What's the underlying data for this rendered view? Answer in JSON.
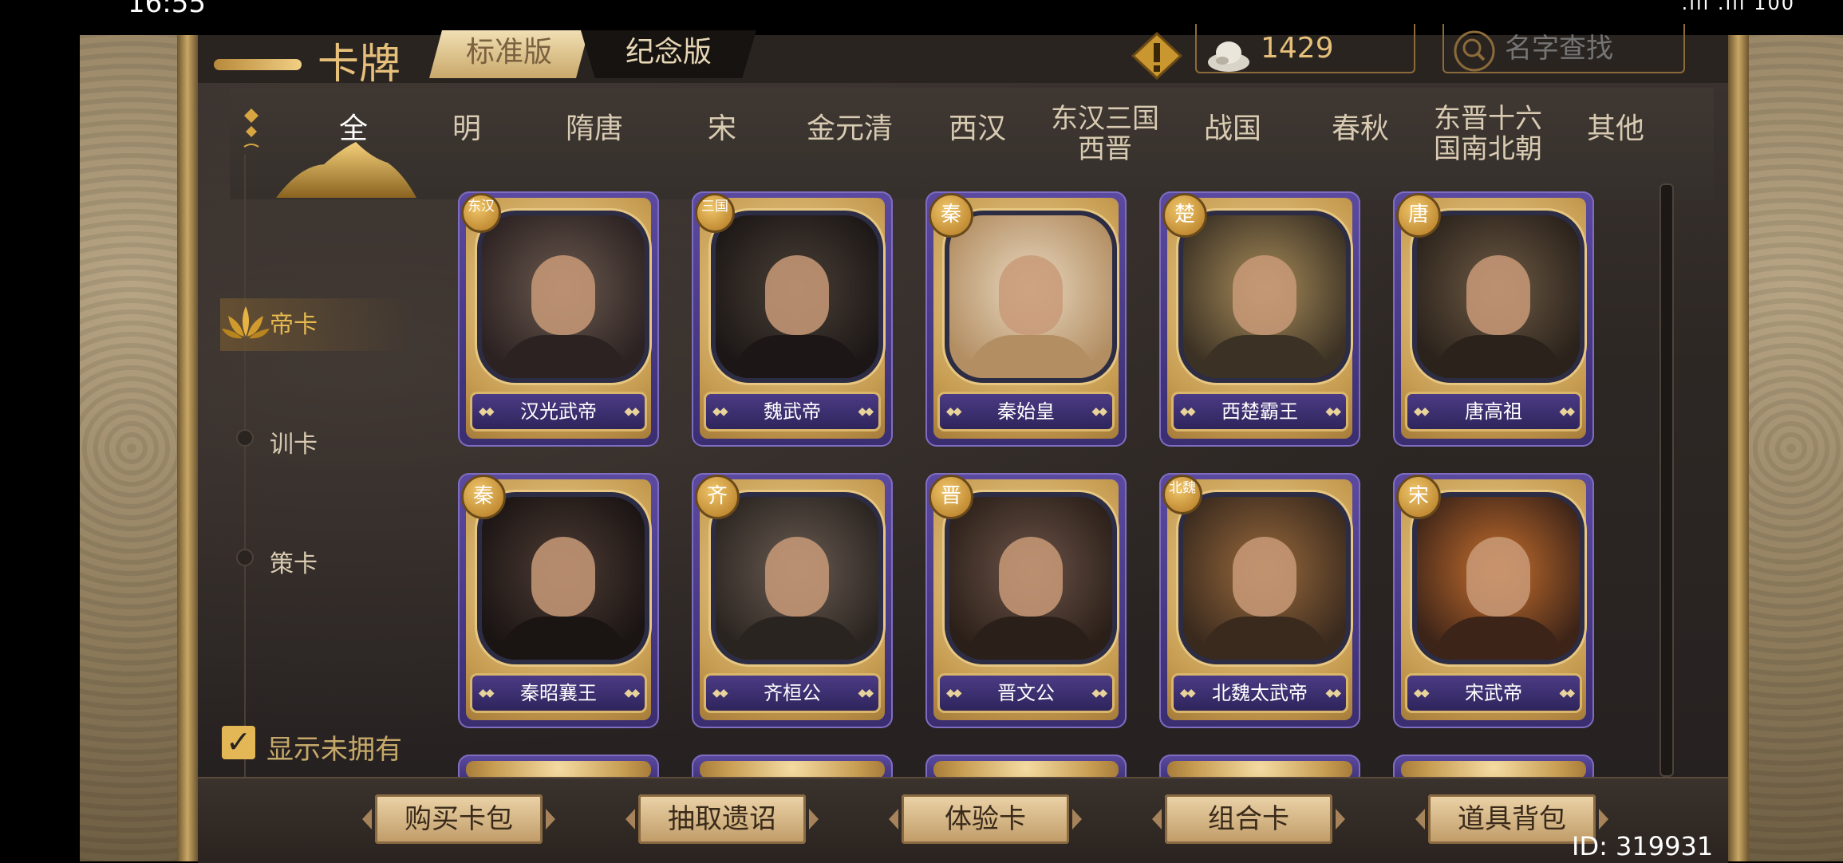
{
  "status_bar": {
    "time": "16:55",
    "right": ".ıll .ıll 100"
  },
  "header": {
    "title": "卡牌",
    "version_tabs": [
      {
        "label": "标准版"
      },
      {
        "label": "纪念版"
      }
    ],
    "currency_value": "1429",
    "search_placeholder": "名字查找"
  },
  "dynasty_tabs": [
    "全",
    "明",
    "隋唐",
    "宋",
    "金元清",
    "西汉",
    "东汉三国\n西晋",
    "战国",
    "春秋",
    "东晋十六\n国南北朝",
    "其他"
  ],
  "side_nav": [
    "帝卡",
    "训卡",
    "策卡"
  ],
  "cards": [
    {
      "badge": "东汉",
      "name": "汉光武帝"
    },
    {
      "badge": "三国",
      "name": "魏武帝"
    },
    {
      "badge": "秦",
      "name": "秦始皇"
    },
    {
      "badge": "楚",
      "name": "西楚霸王"
    },
    {
      "badge": "唐",
      "name": "唐高祖"
    },
    {
      "badge": "秦",
      "name": "秦昭襄王"
    },
    {
      "badge": "齐",
      "name": "齐桓公"
    },
    {
      "badge": "晋",
      "name": "晋文公"
    },
    {
      "badge": "北魏",
      "name": "北魏太武帝"
    },
    {
      "badge": "宋",
      "name": "宋武帝"
    }
  ],
  "show_unowned": {
    "label": "显示未拥有",
    "checked": true
  },
  "bottom_buttons": [
    "购买卡包",
    "抽取遗诏",
    "体验卡",
    "组合卡",
    "道具背包"
  ],
  "user_id": "ID: 319931",
  "colors": {
    "accent_gold": "#e6c07a",
    "card_purple": "#4b3b85",
    "panel_bg": "#2d2724"
  }
}
